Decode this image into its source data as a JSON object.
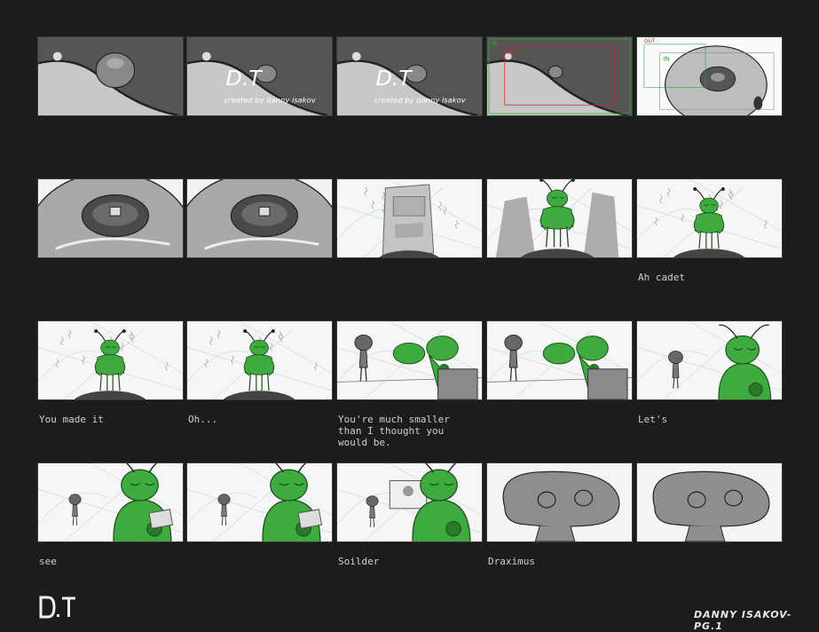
{
  "panels": [
    {
      "id": 1,
      "scene": "space-planet",
      "caption": ""
    },
    {
      "id": 2,
      "scene": "space-title",
      "caption": "",
      "title_logo": "D.T",
      "title_credit": "created by danny isakov"
    },
    {
      "id": 3,
      "scene": "space-title",
      "caption": "",
      "title_logo": "D.T",
      "title_credit": "created by danny isakov"
    },
    {
      "id": 4,
      "scene": "space-frame",
      "caption": "",
      "frame_in": "IN",
      "frame_out": "OUT"
    },
    {
      "id": 5,
      "scene": "dome-frame",
      "caption": "",
      "frame_in": "IN",
      "frame_out": "OUT"
    },
    {
      "id": 6,
      "scene": "dome-closeup",
      "caption": ""
    },
    {
      "id": 7,
      "scene": "dome-closeup",
      "caption": ""
    },
    {
      "id": 8,
      "scene": "door",
      "caption": ""
    },
    {
      "id": 9,
      "scene": "alien-wide",
      "caption": ""
    },
    {
      "id": 10,
      "scene": "alien-mid",
      "caption": "Ah cadet"
    },
    {
      "id": 11,
      "scene": "alien-mid",
      "caption": "You made it"
    },
    {
      "id": 12,
      "scene": "alien-mid",
      "caption": "Oh..."
    },
    {
      "id": 13,
      "scene": "two-shot-lean",
      "caption": "You're much smaller\nthan I thought you\nwould be."
    },
    {
      "id": 14,
      "scene": "two-shot-lean",
      "caption": ""
    },
    {
      "id": 15,
      "scene": "two-shot-far",
      "caption": "Let's"
    },
    {
      "id": 16,
      "scene": "ots-green",
      "caption": "see"
    },
    {
      "id": 17,
      "scene": "ots-green",
      "caption": ""
    },
    {
      "id": 18,
      "scene": "ots-photo",
      "caption": "Soilder"
    },
    {
      "id": 19,
      "scene": "big-head",
      "caption": "Draximus"
    },
    {
      "id": 20,
      "scene": "big-head",
      "caption": ""
    }
  ],
  "footer": {
    "logo": "D.T",
    "credit": "DANNY ISAKOV-PG.1"
  },
  "colors": {
    "background": "#1c1c1c",
    "alien_green": "#3dab3d",
    "alien_dark": "#2a7a2a",
    "grey_character": "#7a7a7a",
    "frame_in": "#2fa82f",
    "frame_out": "#c03030"
  }
}
